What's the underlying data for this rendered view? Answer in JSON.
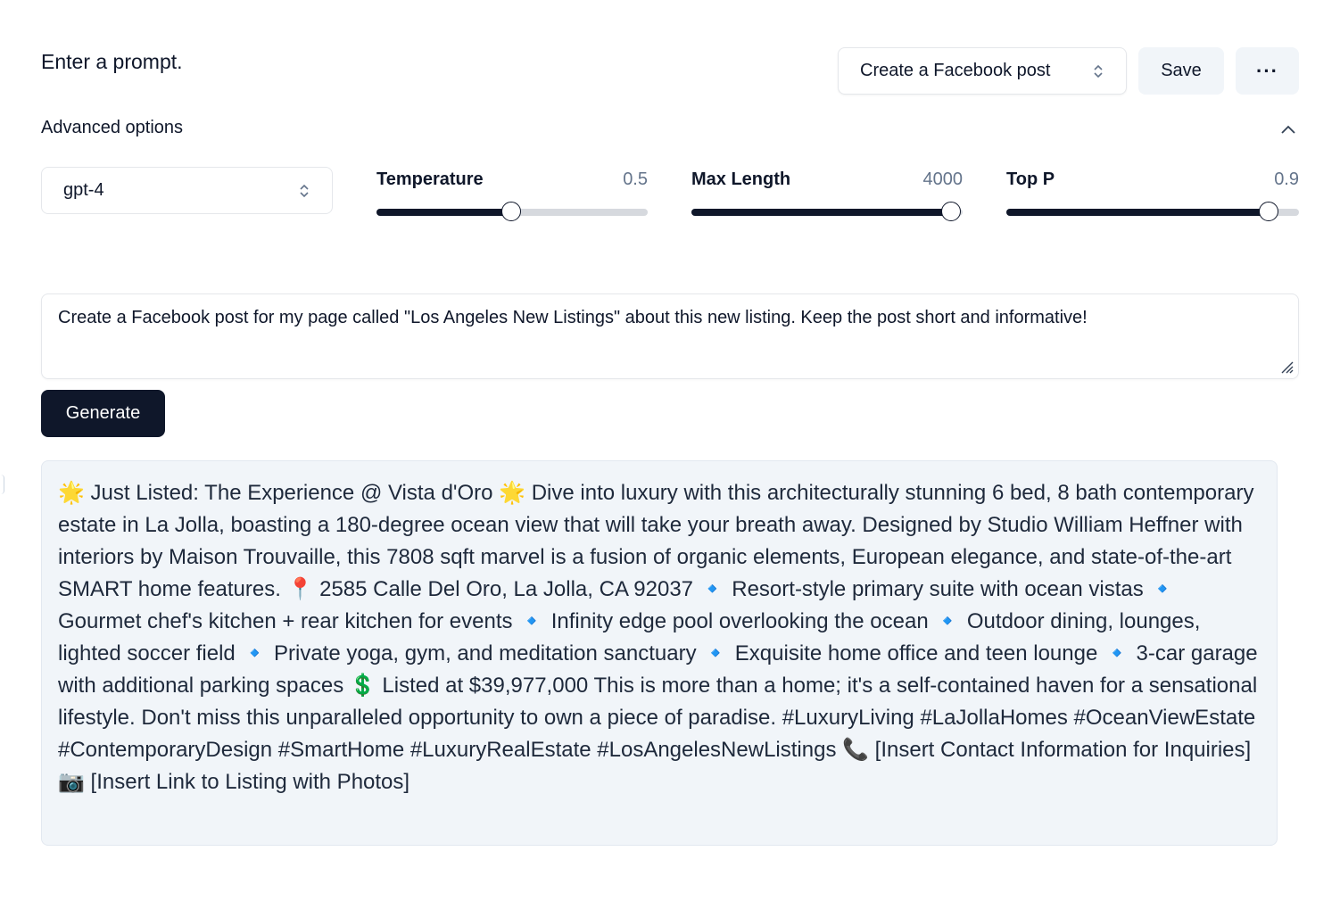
{
  "header": {
    "title": "Enter a prompt.",
    "preset_label": "Create a Facebook post",
    "save_label": "Save",
    "more_label": "···"
  },
  "advanced": {
    "label": "Advanced options",
    "expanded": true,
    "model": "gpt-4",
    "temperature": {
      "label": "Temperature",
      "value": "0.5",
      "fraction": 0.5
    },
    "max_length": {
      "label": "Max Length",
      "value": "4000",
      "fraction": 0.96
    },
    "top_p": {
      "label": "Top P",
      "value": "0.9",
      "fraction": 0.9
    }
  },
  "prompt": {
    "text": "Create a Facebook post for my page called \"Los Angeles New Listings\" about this new listing. Keep the post short and informative!"
  },
  "generate_label": "Generate",
  "output": {
    "text": "🌟 Just Listed: The Experience @ Vista d'Oro 🌟 Dive into luxury with this architecturally stunning 6 bed, 8 bath contemporary estate in La Jolla, boasting a 180-degree ocean view that will take your breath away. Designed by Studio William Heffner with interiors by Maison Trouvaille, this 7808 sqft marvel is a fusion of organic elements, European elegance, and state-of-the-art SMART home features. 📍 2585 Calle Del Oro, La Jolla, CA 92037 🔹 Resort-style primary suite with ocean vistas 🔹 Gourmet chef's kitchen + rear kitchen for events 🔹 Infinity edge pool overlooking the ocean 🔹 Outdoor dining, lounges, lighted soccer field 🔹 Private yoga, gym, and meditation sanctuary 🔹 Exquisite home office and teen lounge 🔹 3-car garage with additional parking spaces 💲 Listed at $39,977,000 This is more than a home; it's a self-contained haven for a sensational lifestyle. Don't miss this unparalleled opportunity to own a piece of paradise. #LuxuryLiving #LaJollaHomes #OceanViewEstate #ContemporaryDesign #SmartHome #LuxuryRealEstate #LosAngelesNewListings 📞 [Insert Contact Information for Inquiries] 📷 [Insert Link to Listing with Photos]"
  }
}
